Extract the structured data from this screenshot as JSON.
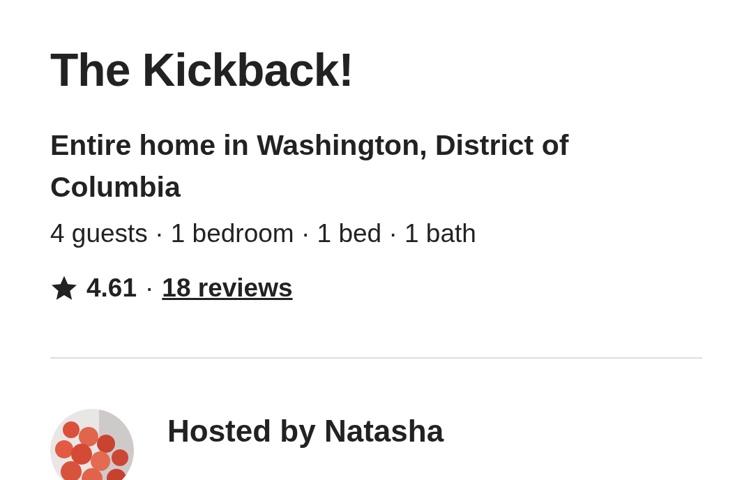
{
  "listing": {
    "title": "The Kickback!",
    "subtitle": "Entire home in Washington, District of Columbia",
    "details": "4 guests · 1 bedroom · 1 bed · 1 bath",
    "rating": "4.61",
    "separator": "·",
    "reviews_link": "18 reviews"
  },
  "host": {
    "title": "Hosted by Natasha"
  }
}
